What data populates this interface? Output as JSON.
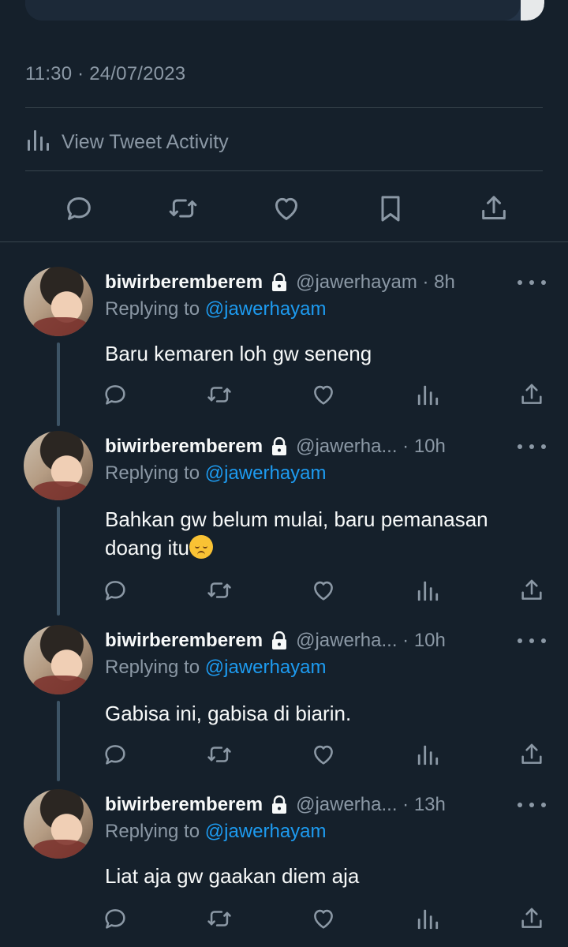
{
  "tweet": {
    "timestamp": "11:30 · 24/07/2023",
    "activity_label": "View Tweet Activity"
  },
  "icons": {
    "reply": "reply-icon",
    "retweet": "retweet-icon",
    "like": "heart-icon",
    "bookmark": "bookmark-icon",
    "share": "share-icon",
    "analytics": "analytics-icon",
    "lock": "lock-icon",
    "more": "more-icon"
  },
  "colors": {
    "background": "#15202b",
    "muted": "#8b98a5",
    "link": "#1d9bf0",
    "text": "#f7f9f9"
  },
  "replies": [
    {
      "name": "biwirberemberem",
      "handle": "@jawerhayam · 8h",
      "replying_prefix": "Replying to ",
      "replying_to": "@jawerhayam",
      "text": "Baru kemaren loh gw seneng"
    },
    {
      "name": "biwirberemberem",
      "handle": "@jawerha... · 10h",
      "replying_prefix": "Replying to ",
      "replying_to": "@jawerhayam",
      "text_line1": "Bahkan gw belum mulai, baru pemanasan",
      "text_line2": "doang itu",
      "emoji": "pensive-face"
    },
    {
      "name": "biwirberemberem",
      "handle": "@jawerha... · 10h",
      "replying_prefix": "Replying to ",
      "replying_to": "@jawerhayam",
      "text": "Gabisa ini, gabisa di biarin."
    },
    {
      "name": "biwirberemberem",
      "handle": "@jawerha... · 13h",
      "replying_prefix": "Replying to ",
      "replying_to": "@jawerhayam",
      "text": "Liat aja gw gaakan diem aja"
    }
  ]
}
